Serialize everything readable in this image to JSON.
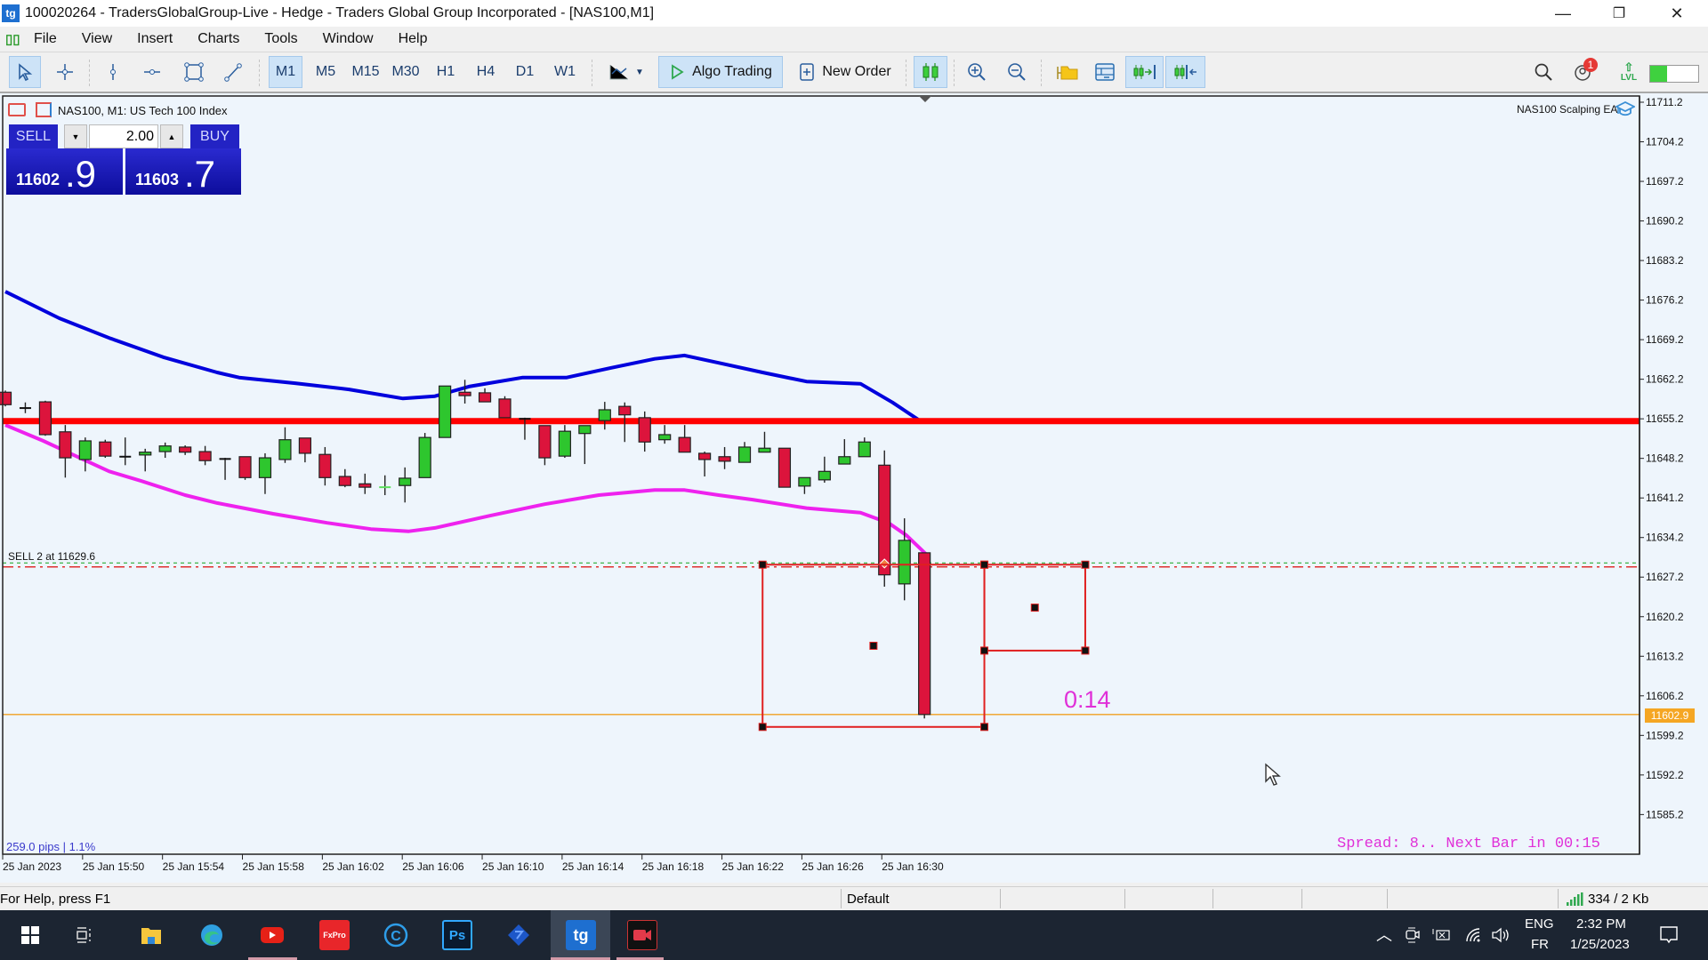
{
  "window": {
    "title": "100020264 - TradersGlobalGroup-Live - Hedge - Traders Global Group Incorporated - [NAS100,M1]",
    "logo": "tg",
    "minimize_icon": "—",
    "restore_icon": "❐",
    "close_icon": "✕"
  },
  "menu": {
    "items": [
      "File",
      "View",
      "Insert",
      "Charts",
      "Tools",
      "Window",
      "Help"
    ]
  },
  "toolbar": {
    "timeframes": [
      "M1",
      "M5",
      "M15",
      "M30",
      "H1",
      "H4",
      "D1",
      "W1"
    ],
    "active_timeframe": "M1",
    "algo_trading_label": "Algo Trading",
    "new_order_label": "New Order",
    "notification_count": "1",
    "level_label": "LVL",
    "level_progress": 0.35
  },
  "chart": {
    "symbol_line": "NAS100, M1:  US Tech 100 Index",
    "ea_name": "NAS100 Scalping EA",
    "one_click": {
      "sell_label": "SELL",
      "buy_label": "BUY",
      "volume": "2.00",
      "sell_price_main": "11602",
      "sell_price_frac": ".9",
      "buy_price_main": "11603",
      "buy_price_frac": ".7"
    },
    "position_label": "SELL 2 at 11629.6",
    "pips_label": "259.0 pips | 1.1%",
    "spread_label": "Spread: 8.. Next Bar in 00:15",
    "timer_label": "0:14",
    "bid_tag": "11602.9"
  },
  "chart_data": {
    "type": "candlestick",
    "symbol": "NAS100",
    "timeframe": "M1",
    "ylim": [
      11580.0,
      11713.0
    ],
    "y_ticks": [
      11711.2,
      11704.2,
      11697.2,
      11690.2,
      11683.2,
      11676.2,
      11669.2,
      11662.2,
      11655.2,
      11648.2,
      11641.2,
      11634.2,
      11627.2,
      11620.2,
      11613.2,
      11606.2,
      11599.2,
      11592.2,
      11585.2
    ],
    "x_ticks": [
      {
        "index": 0,
        "label": "25 Jan 2023"
      },
      {
        "index": 4,
        "label": "25 Jan 15:50"
      },
      {
        "index": 8,
        "label": "25 Jan 15:54"
      },
      {
        "index": 12,
        "label": "25 Jan 15:58"
      },
      {
        "index": 16,
        "label": "25 Jan 16:02"
      },
      {
        "index": 20,
        "label": "25 Jan 16:06"
      },
      {
        "index": 24,
        "label": "25 Jan 16:10"
      },
      {
        "index": 28,
        "label": "25 Jan 16:14"
      },
      {
        "index": 32,
        "label": "25 Jan 16:18"
      },
      {
        "index": 36,
        "label": "25 Jan 16:22"
      },
      {
        "index": 40,
        "label": "25 Jan 16:26"
      },
      {
        "index": 44,
        "label": "25 Jan 16:30"
      }
    ],
    "candles": [
      [
        11659.9,
        11660.2,
        11657.4,
        11657.7
      ],
      [
        11657.1,
        11658.1,
        11656.2,
        11657.1
      ],
      [
        11658.2,
        11658.4,
        11652.2,
        11652.4
      ],
      [
        11652.9,
        11654.1,
        11644.8,
        11648.3
      ],
      [
        11648.0,
        11651.9,
        11645.9,
        11651.3
      ],
      [
        11651.1,
        11651.5,
        11648.3,
        11648.6
      ],
      [
        11648.5,
        11651.9,
        11647.0,
        11648.5
      ],
      [
        11648.8,
        11649.9,
        11645.9,
        11649.3
      ],
      [
        11649.4,
        11651.0,
        11648.3,
        11650.4
      ],
      [
        11650.2,
        11650.5,
        11648.8,
        11649.3
      ],
      [
        11649.4,
        11650.4,
        11647.0,
        11647.8
      ],
      [
        11648.1,
        11648.3,
        11644.4,
        11648.1
      ],
      [
        11648.5,
        11648.5,
        11644.4,
        11644.8
      ],
      [
        11644.8,
        11649.1,
        11641.9,
        11648.3
      ],
      [
        11648.0,
        11653.7,
        11647.4,
        11651.5
      ],
      [
        11651.8,
        11651.8,
        11647.5,
        11649.1
      ],
      [
        11648.9,
        11650.2,
        11643.4,
        11644.8
      ],
      [
        11645.0,
        11646.3,
        11643.1,
        11643.4
      ],
      [
        11643.7,
        11645.5,
        11641.9,
        11643.1
      ],
      [
        11643.1,
        11645.2,
        11641.7,
        11643.1
      ],
      [
        11643.4,
        11646.6,
        11640.4,
        11644.7
      ],
      [
        11644.8,
        11652.7,
        11644.8,
        11651.9
      ],
      [
        11651.9,
        11661.0,
        11651.9,
        11661.0
      ],
      [
        11659.9,
        11662.1,
        11657.9,
        11659.3
      ],
      [
        11659.8,
        11660.6,
        11658.2,
        11658.2
      ],
      [
        11658.7,
        11659.2,
        11655.4,
        11655.4
      ],
      [
        11655.2,
        11655.4,
        11651.5,
        11655.2
      ],
      [
        11654.0,
        11654.0,
        11647.0,
        11648.3
      ],
      [
        11648.6,
        11654.1,
        11648.3,
        11653.0
      ],
      [
        11652.6,
        11654.0,
        11647.2,
        11654.0
      ],
      [
        11654.9,
        11658.2,
        11653.3,
        11656.8
      ],
      [
        11657.4,
        11658.1,
        11651.1,
        11655.9
      ],
      [
        11655.4,
        11656.5,
        11649.4,
        11651.1
      ],
      [
        11651.5,
        11654.1,
        11650.8,
        11652.4
      ],
      [
        11651.9,
        11654.1,
        11649.3,
        11649.3
      ],
      [
        11649.1,
        11649.4,
        11645.0,
        11648.0
      ],
      [
        11648.5,
        11650.2,
        11646.3,
        11647.7
      ],
      [
        11647.5,
        11651.1,
        11647.5,
        11650.2
      ],
      [
        11649.3,
        11652.9,
        11649.3,
        11650.0
      ],
      [
        11650.0,
        11650.0,
        11643.1,
        11643.1
      ],
      [
        11643.3,
        11644.8,
        11641.9,
        11644.8
      ],
      [
        11644.4,
        11648.5,
        11643.9,
        11645.9
      ],
      [
        11647.2,
        11651.6,
        11647.2,
        11648.5
      ],
      [
        11648.5,
        11651.9,
        11648.5,
        11651.1
      ],
      [
        11647.0,
        11649.6,
        11625.5,
        11627.6
      ],
      [
        11626.0,
        11637.6,
        11623.1,
        11633.7
      ],
      [
        11631.5,
        11631.5,
        11602.2,
        11602.9
      ]
    ],
    "candle_format": [
      "open",
      "high",
      "low",
      "close"
    ],
    "upper_band": [
      [
        0,
        11677.7
      ],
      [
        2.7,
        11673.0
      ],
      [
        5.2,
        11669.5
      ],
      [
        7.9,
        11666.1
      ],
      [
        10.6,
        11663.4
      ],
      [
        11.7,
        11662.5
      ],
      [
        14.5,
        11661.5
      ],
      [
        17.2,
        11660.4
      ],
      [
        19.9,
        11658.8
      ],
      [
        21.5,
        11659.2
      ],
      [
        23.2,
        11660.9
      ],
      [
        25.9,
        11662.5
      ],
      [
        28.1,
        11662.5
      ],
      [
        30.3,
        11664.2
      ],
      [
        32.5,
        11665.8
      ],
      [
        34.0,
        11666.4
      ],
      [
        35.7,
        11665.1
      ],
      [
        37.9,
        11663.4
      ],
      [
        40.1,
        11661.8
      ],
      [
        42.8,
        11661.4
      ],
      [
        44.4,
        11658.1
      ],
      [
        45.8,
        11654.8
      ]
    ],
    "lower_band": [
      [
        0,
        11654.1
      ],
      [
        1.9,
        11651.3
      ],
      [
        3.6,
        11648.5
      ],
      [
        5.2,
        11645.9
      ],
      [
        6.8,
        11644.2
      ],
      [
        9.0,
        11641.7
      ],
      [
        10.6,
        11640.3
      ],
      [
        13.4,
        11638.4
      ],
      [
        16.1,
        11636.8
      ],
      [
        18.3,
        11635.7
      ],
      [
        20.2,
        11635.3
      ],
      [
        21.5,
        11635.9
      ],
      [
        24.3,
        11638.1
      ],
      [
        27.0,
        11640.1
      ],
      [
        29.7,
        11641.7
      ],
      [
        32.5,
        11642.6
      ],
      [
        34.0,
        11642.6
      ],
      [
        35.7,
        11641.7
      ],
      [
        37.4,
        11640.9
      ],
      [
        40.1,
        11639.4
      ],
      [
        42.8,
        11638.6
      ],
      [
        44.2,
        11636.8
      ],
      [
        45.1,
        11634.6
      ],
      [
        46.1,
        11631.2
      ]
    ],
    "horizontal_levels": [
      {
        "name": "resistance-line",
        "price": 11654.8,
        "color": "#ff0000"
      },
      {
        "name": "entry-line",
        "price": 11629.7,
        "color": "#3cb44b",
        "style": "dotted"
      },
      {
        "name": "stop-line",
        "price": 11629.0,
        "color": "#e03030",
        "style": "dashdot"
      },
      {
        "name": "bid-line",
        "price": 11602.9,
        "color": "#f0a020"
      }
    ],
    "rectangles": [
      {
        "name": "range-box-large",
        "from_index": 37.9,
        "to_index": 49.0,
        "top": 11629.4,
        "bottom": 11600.7,
        "color": "#e02020"
      },
      {
        "name": "range-box-small",
        "from_index": 49.0,
        "to_index": 54.05,
        "top": 11629.4,
        "bottom": 11614.2,
        "color": "#e02020"
      }
    ],
    "colors": {
      "bull": "#2ec62e",
      "bear": "#dc143c",
      "upper_band": "#0000dd",
      "lower_band": "#ee22ee",
      "background": "#eef5fc"
    }
  },
  "statusbar": {
    "help_text": "For Help, press F1",
    "profile": "Default",
    "traffic": "334 / 2 Kb"
  },
  "taskbar": {
    "apps": [
      "start",
      "task-view",
      "file-explorer",
      "edge",
      "youtube",
      "fxpro",
      "c-app",
      "photoshop",
      "diamond-app",
      "traders-global",
      "screen-recorder"
    ],
    "fxpro_label": "FxPro",
    "ps_label": "Ps",
    "tg_label": "tg",
    "lang_top": "ENG",
    "lang_bottom": "FR",
    "time": "2:32 PM",
    "date": "1/25/2023"
  }
}
